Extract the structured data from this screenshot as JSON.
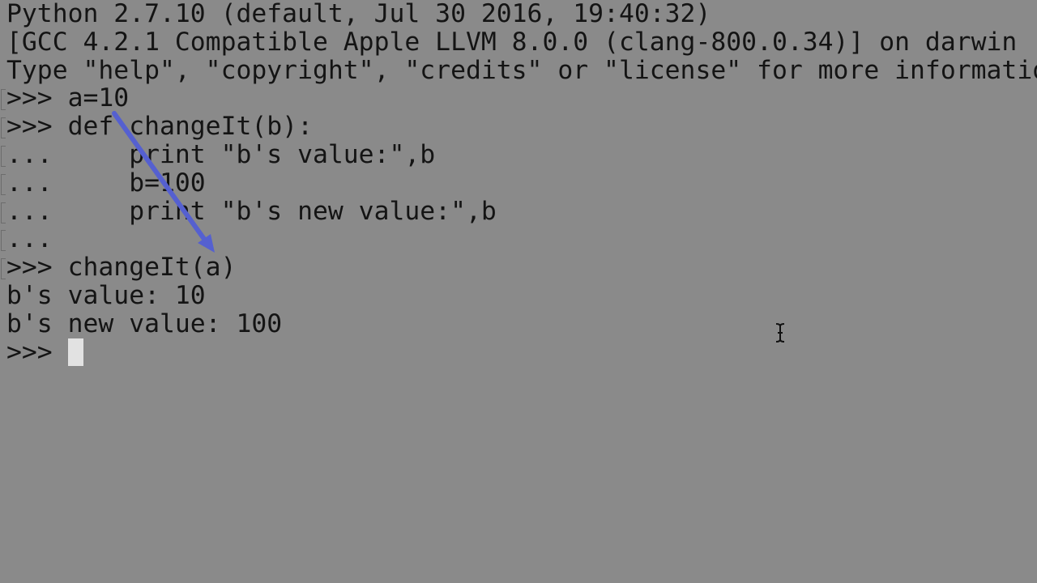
{
  "terminal": {
    "lines": [
      {
        "text": "Python 2.7.10 (default, Jul 30 2016, 19:40:32)",
        "input": false
      },
      {
        "text": "[GCC 4.2.1 Compatible Apple LLVM 8.0.0 (clang-800.0.34)] on darwin",
        "input": false
      },
      {
        "text": "Type \"help\", \"copyright\", \"credits\" or \"license\" for more information.",
        "input": false
      },
      {
        "text": ">>> a=10",
        "input": true
      },
      {
        "text": ">>> def changeIt(b):",
        "input": true
      },
      {
        "text": "...     print \"b's value:\",b",
        "input": true
      },
      {
        "text": "...     b=100",
        "input": true
      },
      {
        "text": "...     print \"b's new value:\",b",
        "input": true
      },
      {
        "text": "...",
        "input": true
      },
      {
        "text": ">>> changeIt(a)",
        "input": true
      },
      {
        "text": "b's value: 10",
        "input": false
      },
      {
        "text": "b's new value: 100",
        "input": false
      },
      {
        "text": ">>> ",
        "input": false
      }
    ]
  },
  "colors": {
    "background": "#8a8a8a",
    "text": "#141414",
    "annotation_arrow": "#5560d0",
    "cursor": "#e2e2e2"
  },
  "icons": {
    "annotation": "arrow-annotation",
    "mouse_cursor": "i-beam-cursor",
    "text_cursor": "block-cursor"
  }
}
